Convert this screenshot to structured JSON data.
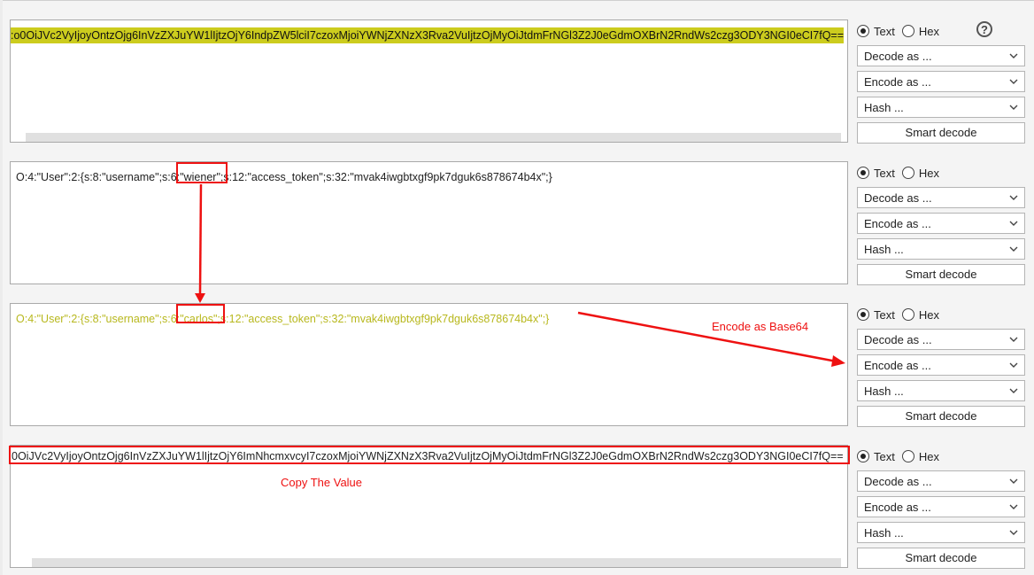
{
  "rows": [
    {
      "text_segments": [
        {
          "text": ":o0OiJVc2VyIjoyOntzOjg6InVzZXJuYW1lIjtzOjY6IndpZW5lciI7czoxMjoiYWNjZXNzX3Rva2VuIjtzOjMyOiJtdmFrNGl3Z2J0eGdmOXBrN2RndWs2czg3ODY3NGI0eCI7fQ=="
        }
      ],
      "format": "Text",
      "hex_label": "Hex",
      "text_label": "Text",
      "decode_label": "Decode as ...",
      "encode_label": "Encode as ...",
      "hash_label": "Hash ...",
      "smart_label": "Smart decode"
    },
    {
      "text_segments": [
        {
          "text": "O:4:\"User\":2:{s:8:\"username\";s:6:"
        },
        {
          "text": "\"wiener\";"
        },
        {
          "text": "s:12:\"access_token\";s:32:\"mvak4iwgbtxgf9pk7dguk6s878674b4x\";}"
        }
      ],
      "format": "Text",
      "hex_label": "Hex",
      "text_label": "Text",
      "decode_label": "Decode as ...",
      "encode_label": "Encode as ...",
      "hash_label": "Hash ...",
      "smart_label": "Smart decode"
    },
    {
      "text_segments": [
        {
          "text": "O:4:\"User\":2:{s:8:\"username\";s:6:"
        },
        {
          "text": "\"carlos\";"
        },
        {
          "text": "s:12:\"access_token\";s:32:\"mvak4iwgbtxgf9pk7dguk6s878674b4x\";}"
        }
      ],
      "format": "Text",
      "hex_label": "Hex",
      "text_label": "Text",
      "decode_label": "Decode as ...",
      "encode_label": "Encode as ...",
      "hash_label": "Hash ...",
      "smart_label": "Smart decode"
    },
    {
      "text_segments": [
        {
          "text": "0OiJVc2VyIjoyOntzOjg6InVzZXJuYW1lIjtzOjY6ImNhcmxvcyI7czoxMjoiYWNjZXNzX3Rva2VuIjtzOjMyOiJtdmFrNGl3Z2J0eGdmOXBrN2RndWs2czg3ODY3NGI0eCI7fQ=="
        }
      ],
      "format": "Text",
      "hex_label": "Hex",
      "text_label": "Text",
      "decode_label": "Decode as ...",
      "encode_label": "Encode as ...",
      "hash_label": "Hash ...",
      "smart_label": "Smart decode"
    }
  ],
  "help_icon": "?",
  "annotations": {
    "encode_note": "Encode as Base64",
    "copy_note": "Copy The Value"
  },
  "icons": {
    "help": "help-circle-icon",
    "dropdown": "chevron-down-icon"
  },
  "colors": {
    "highlight_yellow": "#cccc1e",
    "olive_text": "#b8b81e",
    "annotation_red": "#e11111"
  }
}
